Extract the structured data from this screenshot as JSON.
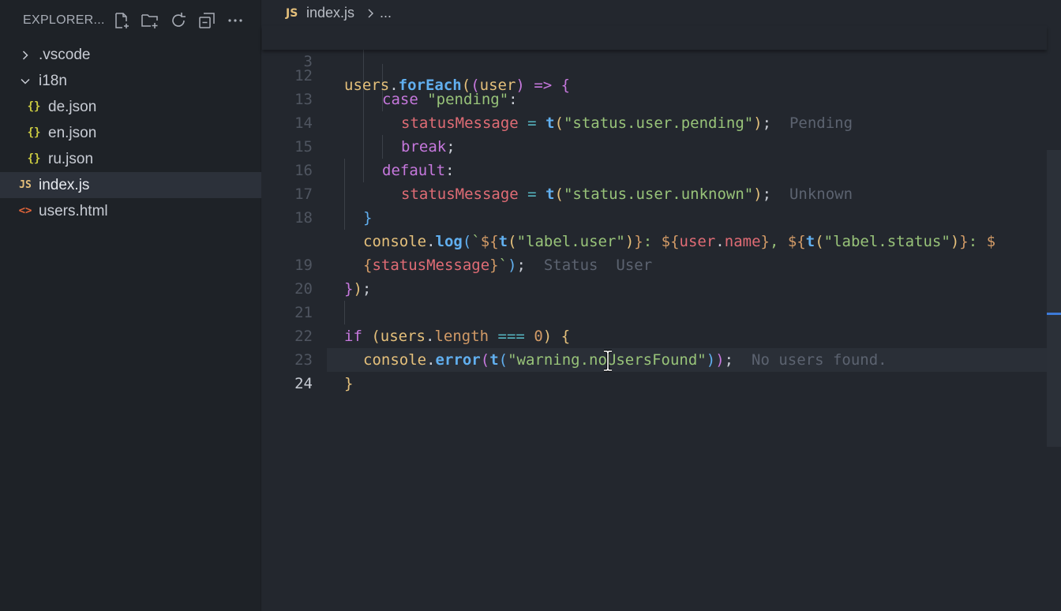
{
  "explorer": {
    "title": "EXPLORER...",
    "header_icons": [
      "new-file-icon",
      "new-folder-icon",
      "refresh-icon",
      "collapse-all-icon",
      "more-icon"
    ],
    "tree": [
      {
        "label": ".vscode",
        "kind": "folder",
        "expanded": false
      },
      {
        "label": "i18n",
        "kind": "folder",
        "expanded": true
      },
      {
        "label": "de.json",
        "kind": "json",
        "icon_text": "{}"
      },
      {
        "label": "en.json",
        "kind": "json",
        "icon_text": "{}"
      },
      {
        "label": "ru.json",
        "kind": "json",
        "icon_text": "{}"
      },
      {
        "label": "index.js",
        "kind": "js",
        "icon_text": "JS",
        "selected": true
      },
      {
        "label": "users.html",
        "kind": "html",
        "icon_text": "<>"
      }
    ]
  },
  "breadcrumb": {
    "file_icon_text": "JS",
    "file": "index.js",
    "more": "..."
  },
  "editor": {
    "sticky_line": {
      "number": "3",
      "code": "users.forEach((user) => {"
    },
    "lines": [
      {
        "number": "12",
        "code": "case \"pending\":"
      },
      {
        "number": "13",
        "code": "statusMessage = t(\"status.user.pending\");",
        "hint": "Pending"
      },
      {
        "number": "14",
        "code": "break;"
      },
      {
        "number": "15",
        "code": "default:"
      },
      {
        "number": "16",
        "code": "statusMessage = t(\"status.user.unknown\");",
        "hint": "Unknown"
      },
      {
        "number": "17",
        "code": "}"
      },
      {
        "number": "18",
        "code": "console.log(`${t(\"label.user\")}: ${user.name}, ${t(\"label.status\")}: $",
        "hints": [
          "Status",
          "User"
        ]
      },
      {
        "number": "",
        "code": "{statusMessage}`);"
      },
      {
        "number": "19",
        "code": "});"
      },
      {
        "number": "20",
        "code": ""
      },
      {
        "number": "21",
        "code": "if (users.length === 0) {"
      },
      {
        "number": "22",
        "code": "console.error(t(\"warning.noUsersFound\"));",
        "hint": "No users found."
      },
      {
        "number": "23",
        "code": "}"
      },
      {
        "number": "24",
        "code": ""
      }
    ]
  },
  "colors": {
    "sidebar_bg": "#1e2227",
    "editor_bg": "#23272e",
    "keyword": "#c678dd",
    "function": "#61afef",
    "string": "#98c379",
    "variable": "#e06c75",
    "number": "#d19a66",
    "hint": "#5c6370",
    "js_icon": "#e5c07b",
    "html_icon": "#e0653a"
  }
}
